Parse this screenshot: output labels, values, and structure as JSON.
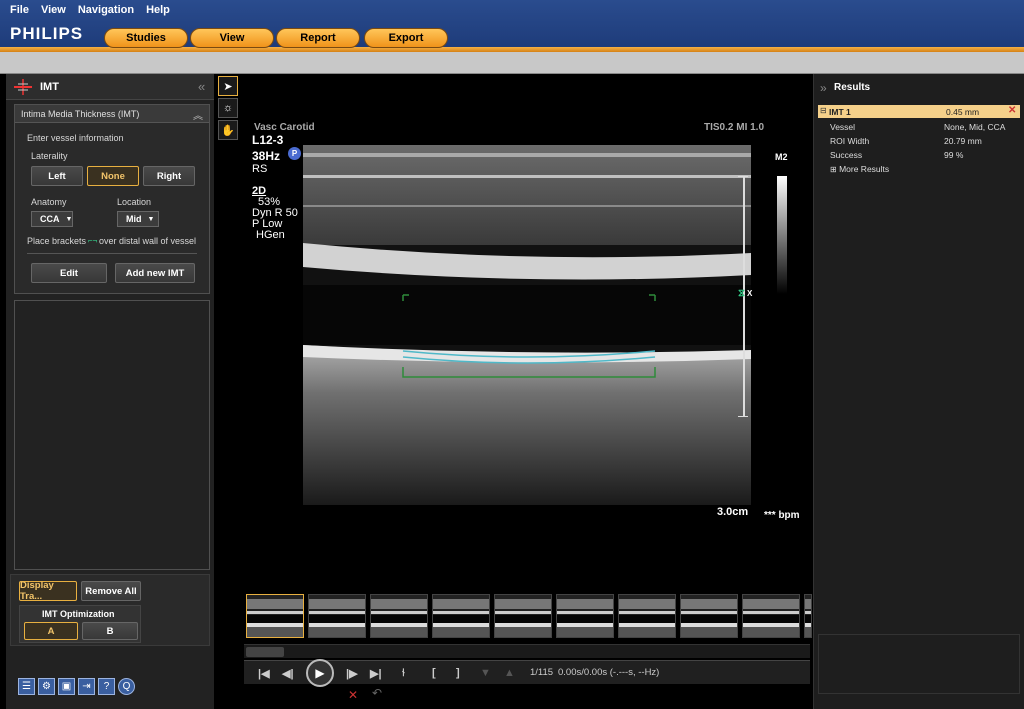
{
  "menu": [
    "File",
    "View",
    "Navigation",
    "Help"
  ],
  "brand": "PHILIPS",
  "tabs": [
    "Studies",
    "View",
    "Report",
    "Export"
  ],
  "left_panel": {
    "title": "IMT",
    "section_title": "Intima Media Thickness (IMT)",
    "enter_vessel": "Enter vessel information",
    "laterality_label": "Laterality",
    "laterality": [
      "Left",
      "None",
      "Right"
    ],
    "laterality_selected": "None",
    "anatomy_label": "Anatomy",
    "anatomy_value": "CCA",
    "location_label": "Location",
    "location_value": "Mid",
    "instruction_part1": "Place brackets",
    "instruction_part2": "over distal wall of vessel",
    "edit": "Edit",
    "add_new": "Add new IMT",
    "display_traces": "Display Tra...",
    "remove_all": "Remove All",
    "optimization_title": "IMT Optimization",
    "opt_a": "A",
    "opt_b": "B"
  },
  "image_overlay": {
    "probe": "L12-3",
    "freq": "38Hz",
    "rs": "RS",
    "mode": "2D",
    "gain": "53%",
    "dyn": "Dyn R 50",
    "power": "P Low",
    "hgen": "HGen",
    "badge": "P",
    "top_left_cut": "Vasc Carotid",
    "top_right_cut": "TIS0.2  MI 1.0",
    "m2": "M2",
    "depth": "3.0cm",
    "bpm": "*** bpm",
    "x_marker": "X"
  },
  "results": {
    "title": "Results",
    "name": "IMT 1",
    "value": "0.45 mm",
    "rows": [
      {
        "label": "Vessel",
        "value": "None, Mid, CCA"
      },
      {
        "label": "ROI Width",
        "value": "20.79 mm"
      },
      {
        "label": "Success",
        "value": "99 %"
      }
    ],
    "more": "More Results"
  },
  "playback": {
    "frame": "1/115",
    "time": "0.00s/0.00s (-.---s, --Hz)"
  },
  "colors": {
    "accent": "#f0a030",
    "brand_blue": "#1f3f80",
    "result_highlight": "#f5d08a",
    "trace_cyan": "#4fb8c8",
    "roi_green": "#2e8b3a"
  }
}
